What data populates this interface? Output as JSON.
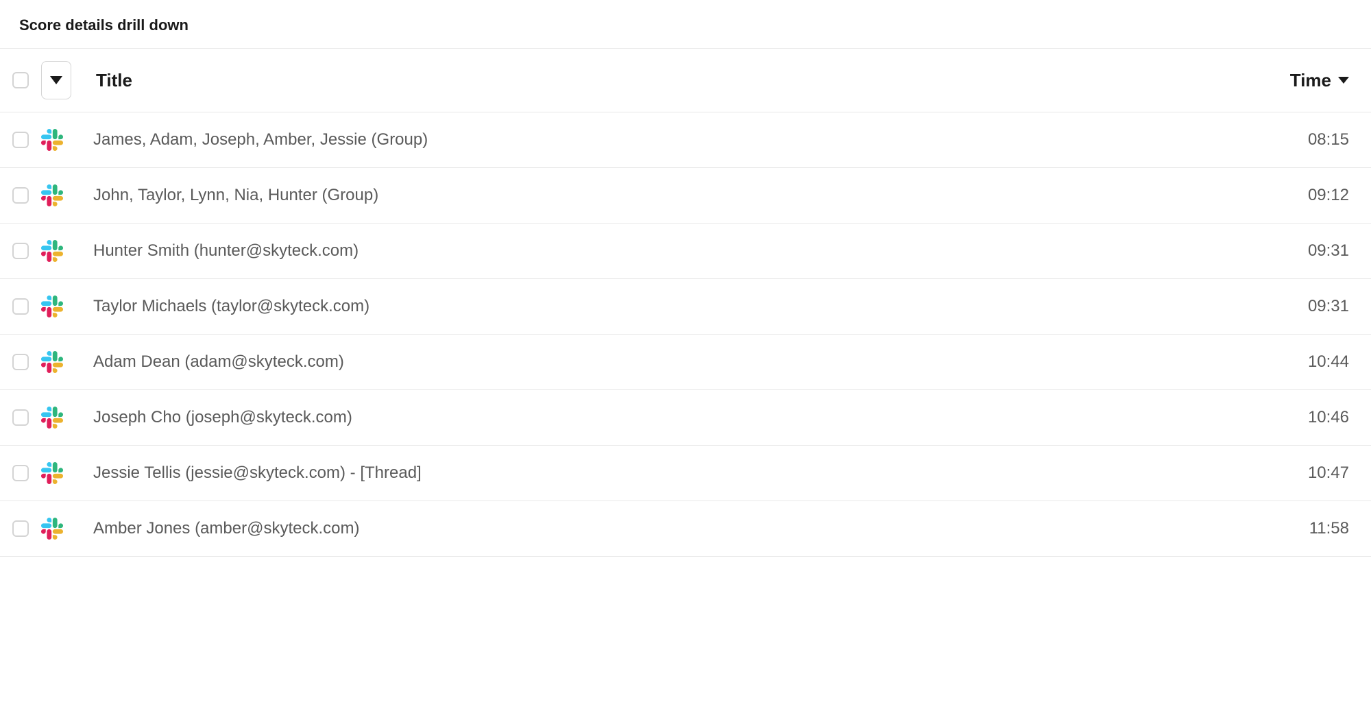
{
  "section_title": "Score details drill down",
  "table": {
    "columns": {
      "title_label": "Title",
      "time_label": "Time"
    },
    "sort": {
      "column": "time",
      "direction": "asc"
    },
    "rows": [
      {
        "icon": "slack-icon",
        "title": "James, Adam, Joseph, Amber, Jessie (Group)",
        "time": "08:15"
      },
      {
        "icon": "slack-icon",
        "title": "John, Taylor, Lynn, Nia, Hunter (Group)",
        "time": "09:12"
      },
      {
        "icon": "slack-icon",
        "title": "Hunter Smith (hunter@skyteck.com)",
        "time": "09:31"
      },
      {
        "icon": "slack-icon",
        "title": "Taylor Michaels (taylor@skyteck.com)",
        "time": "09:31"
      },
      {
        "icon": "slack-icon",
        "title": "Adam Dean (adam@skyteck.com)",
        "time": "10:44"
      },
      {
        "icon": "slack-icon",
        "title": "Joseph Cho (joseph@skyteck.com)",
        "time": "10:46"
      },
      {
        "icon": "slack-icon",
        "title": "Jessie Tellis (jessie@skyteck.com) - [Thread]",
        "time": "10:47"
      },
      {
        "icon": "slack-icon",
        "title": "Amber Jones (amber@skyteck.com)",
        "time": "11:58"
      }
    ]
  }
}
